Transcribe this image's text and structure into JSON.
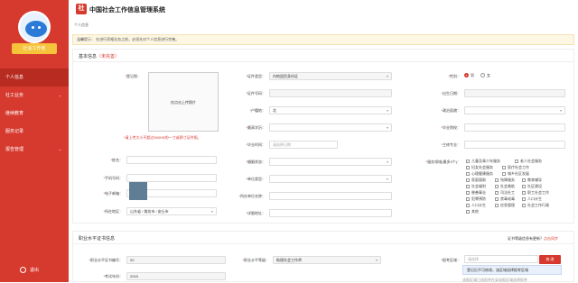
{
  "sidebar": {
    "role": "社会工作者",
    "items": [
      {
        "label": "个人信息",
        "active": true
      },
      {
        "label": "社工业务",
        "chevron": true
      },
      {
        "label": "继续教育"
      },
      {
        "label": "服务记录"
      },
      {
        "label": "报告管理",
        "chevron": true
      }
    ],
    "logout": "退出",
    "accent": "#d63a2e"
  },
  "header": {
    "logo": "社",
    "title": "中国社会工作信息管理系统"
  },
  "breadcrumb": "个人信息",
  "notice": "温馨提示：  在进行资格业务之前，必须先对个人信息进行完善。",
  "basic": {
    "title": "基本信息",
    "tag": "（未完善）",
    "fields": {
      "reg_no": "登记照：",
      "photo_placeholder": "仅点击上传照片",
      "photo_tip": "*请上传大小不超过500KB的一寸或两寸证件照。",
      "name": "姓名：",
      "phone": "手机号码：",
      "email": "电子邮箱：",
      "region": "所在地区：",
      "region_value": "山东省 / 潍坊市 / 安丘市",
      "cert_type": "证件类型：",
      "cert_type_value": "内地居民身份证",
      "cert_no": "证件号码：",
      "hukou": "户籍地：",
      "hukou_value": "北",
      "edu": "最高学历：",
      "grad_time": "毕业时间：",
      "grad_time_placeholder": "请选择日期",
      "marital": "婚姻状态：",
      "unit_type": "单位类型：",
      "unit_name": "所在单位名称：",
      "address": "详细地址：",
      "gender": "性别：",
      "male": "男",
      "female": "女",
      "birth": "出生日期：",
      "politics": "政治面貌：",
      "degree": "毕业院校：",
      "major": "主修专业：",
      "service_field": "服务领域(最多3个)："
    },
    "service_options": [
      "儿童及青少年服务",
      "老人社会服务",
      "妇女社会服务",
      "医疗社会工作",
      "心理健康服务",
      "城乡社区发展",
      "家庭援助",
      "残障服务",
      "教育辅导",
      "社会福利",
      "社会救助",
      "社区建设",
      "慈善事业",
      "司法社工",
      "职工社会工作",
      "犯罪预防",
      "禁毒戒毒",
      "人口计生",
      "人口计生",
      "应急管理",
      "社会工作行政",
      "其他"
    ]
  },
  "qual": {
    "title": "职业水平证书信息",
    "hint": "证书等级信息有更新？",
    "hint_link": "点击同步",
    "cert_no": "职业水平证书编号：",
    "cert_no_value": "20",
    "level": "职业水平等级：",
    "level_value": "助理社会工作师",
    "exam_year": "考试年份：",
    "exam_year_value": "2015",
    "reg_region": "报考区域：",
    "reg_region_value": "请选择",
    "edit": "修 改",
    "tooltip": "登记后不可修改，该区域选择报考区域",
    "footer": "该报区域已选报考在录该报区域选择报考"
  }
}
